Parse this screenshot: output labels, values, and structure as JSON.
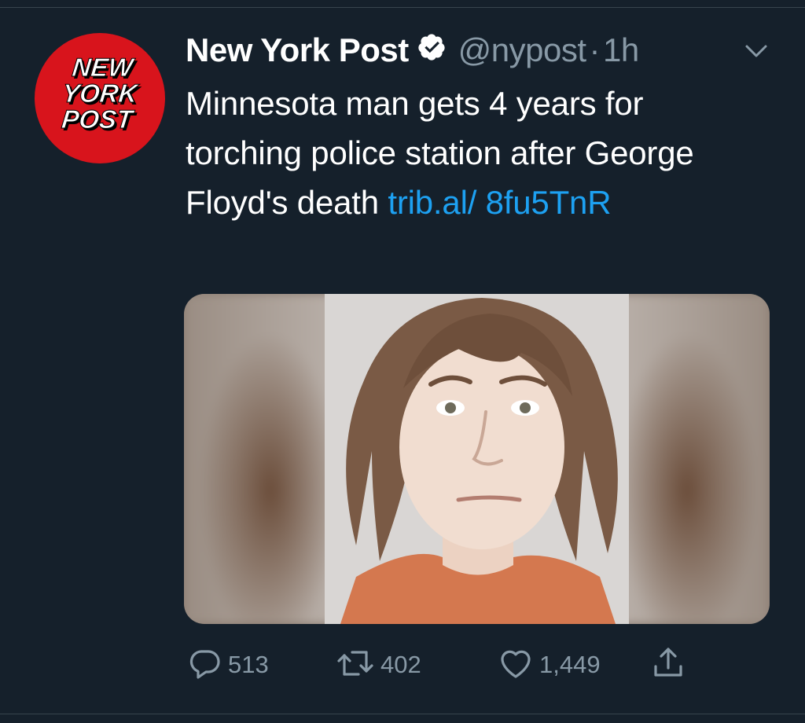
{
  "tweet": {
    "author_name": "New York Post",
    "handle": "@nypost",
    "separator": "·",
    "time": "1h",
    "verified": true,
    "text": "Minnesota man gets 4 years for torching police station after George Floyd's death",
    "link_text": "trib.al/ 8fu5TnR",
    "avatar": {
      "logo_lines": [
        "NEW",
        "YORK",
        "POST"
      ],
      "background": "#d8141c"
    },
    "media": {
      "kind": "mugshot photo"
    },
    "actions": {
      "reply": {
        "icon": "reply-icon",
        "count": "513"
      },
      "retweet": {
        "icon": "retweet-icon",
        "count": "402"
      },
      "like": {
        "icon": "heart-icon",
        "count": "1,449"
      },
      "share": {
        "icon": "share-icon"
      }
    }
  },
  "colors": {
    "background": "#15202b",
    "text": "#ffffff",
    "muted": "#8899a6",
    "link": "#1da1f2",
    "divider": "#38444d"
  }
}
